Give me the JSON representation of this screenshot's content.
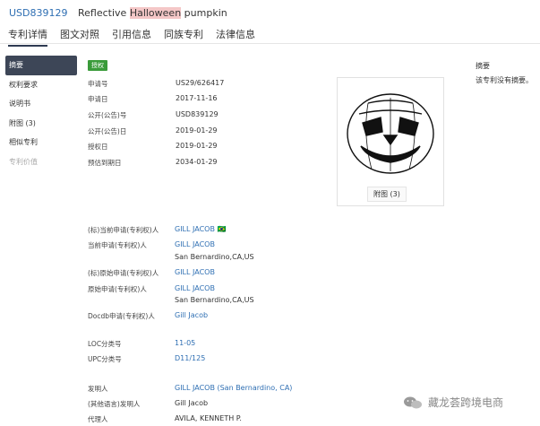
{
  "header": {
    "patent_number": "USD839129",
    "title_pre": "Reflective ",
    "title_hl": "Halloween",
    "title_post": " pumpkin"
  },
  "tabs": [
    {
      "label": "专利详情"
    },
    {
      "label": "图文对照"
    },
    {
      "label": "引用信息"
    },
    {
      "label": "同族专利"
    },
    {
      "label": "法律信息"
    }
  ],
  "sidebar": {
    "items": [
      {
        "label": "摘要"
      },
      {
        "label": "权利要求"
      },
      {
        "label": "说明书"
      },
      {
        "label": "附图 (3)"
      },
      {
        "label": "相似专利"
      },
      {
        "label": "专利价值"
      }
    ]
  },
  "status_badge": "授权",
  "fields": [
    {
      "label": "申请号",
      "value": "US29/626417"
    },
    {
      "label": "申请日",
      "value": "2017-11-16"
    },
    {
      "label": "公开(公告)号",
      "value": "USD839129"
    },
    {
      "label": "公开(公告)日",
      "value": "2019-01-29"
    },
    {
      "label": "授权日",
      "value": "2019-01-29"
    },
    {
      "label": "预估到期日",
      "value": "2034-01-29"
    }
  ],
  "parties": [
    {
      "label": "(标)当前申请(专利权)人",
      "value": "GILL JACOB",
      "flag": "🇧🇷"
    },
    {
      "label": "当前申请(专利权)人",
      "value": "GILL JACOB",
      "addr": "San Bernardino,CA,US"
    },
    {
      "label": "(标)原始申请(专利权)人",
      "value": "GILL JACOB"
    },
    {
      "label": "原始申请(专利权)人",
      "value": "GILL JACOB",
      "addr": "San Bernardino,CA,US"
    },
    {
      "label": "Docdb申请(专利权)人",
      "value": "Gill Jacob"
    }
  ],
  "classes": [
    {
      "label": "LOC分类号",
      "value": "11-05"
    },
    {
      "label": "UPC分类号",
      "value": "D11/125"
    }
  ],
  "inventors": [
    {
      "label": "发明人",
      "value": "GILL JACOB (San Bernardino, CA)"
    },
    {
      "label": "(其他语言)发明人",
      "value": "Gill Jacob"
    },
    {
      "label": "代理人",
      "value": "AVILA, KENNETH P."
    }
  ],
  "figure": {
    "button_label": "附图 (3)",
    "icon": "pumpkin-drawing"
  },
  "abstract": {
    "title": "摘要",
    "text": "该专利没有摘要。"
  },
  "watermark": {
    "text": "藏龙荟跨境电商",
    "icon": "wechat-icon"
  },
  "colors": {
    "link": "#2f6fb3",
    "badge": "#3a9b3a",
    "active_nav": "#3d4657",
    "highlight": "#f4c7c7"
  }
}
